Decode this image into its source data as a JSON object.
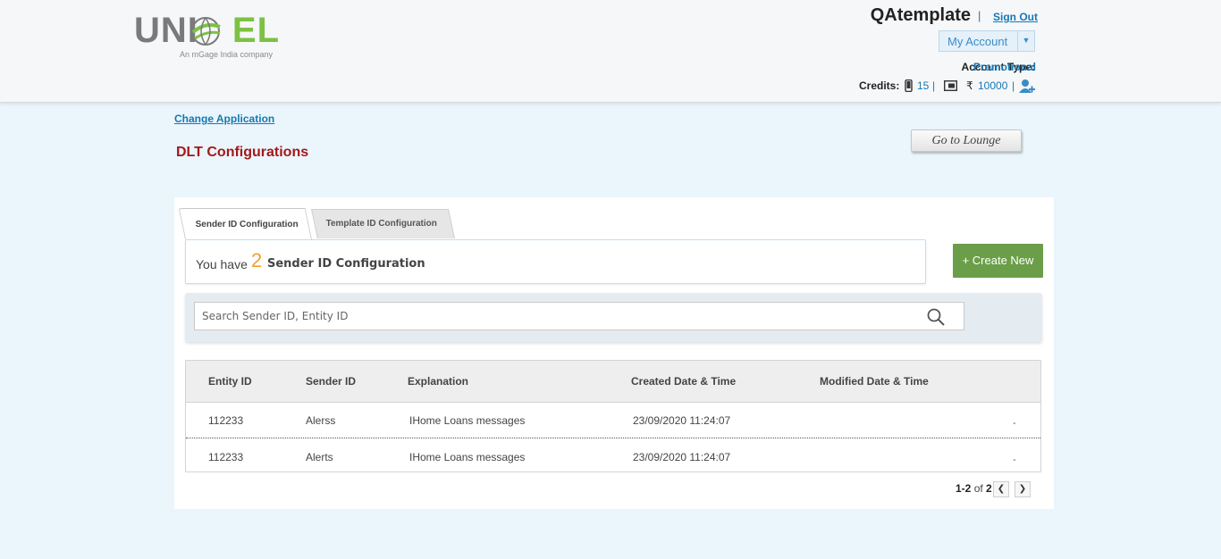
{
  "brand": {
    "logo_text_left": "UNI",
    "logo_text_right": "EL",
    "tagline": "An mGage India company"
  },
  "header": {
    "user_name": "QAtemplate",
    "separator": "|",
    "sign_out": "Sign Out",
    "my_account": "My Account",
    "account_type_label": "Account Type:",
    "account_type_value": "Promotional",
    "credits_label": "Credits:",
    "sms_credits": "15",
    "currency_symbol": "₹",
    "wallet_credits": "10000"
  },
  "page": {
    "change_application": "Change Application",
    "title": "DLT Configurations",
    "go_to_lounge": "Go to Lounge"
  },
  "tabs": [
    {
      "label": "Sender ID Configuration",
      "active": true
    },
    {
      "label": "Template ID Configuration",
      "active": false
    }
  ],
  "summary": {
    "prefix": "You have",
    "count": "2",
    "suffix": "Sender ID Configuration"
  },
  "create_new": "+ Create New",
  "search": {
    "placeholder": "Search Sender ID, Entity ID"
  },
  "table": {
    "columns": [
      "Entity ID",
      "Sender ID",
      "Explanation",
      "Created Date & Time",
      "Modified Date & Time"
    ],
    "rows": [
      {
        "entity_id": "112233",
        "sender_id": "Alerss",
        "explanation": "IHome Loans messages",
        "created": "23/09/2020 11:24:07",
        "modified": "",
        "action": "-"
      },
      {
        "entity_id": "112233",
        "sender_id": "Alerts",
        "explanation": "IHome Loans messages",
        "created": "23/09/2020 11:24:07",
        "modified": "",
        "action": "-"
      }
    ]
  },
  "pager": {
    "range": "1-2",
    "of": "of",
    "total": "2"
  },
  "colors": {
    "accent_blue": "#1579b4",
    "title_red": "#a31919",
    "create_green": "#6a9e48",
    "count_orange": "#f0a030"
  }
}
